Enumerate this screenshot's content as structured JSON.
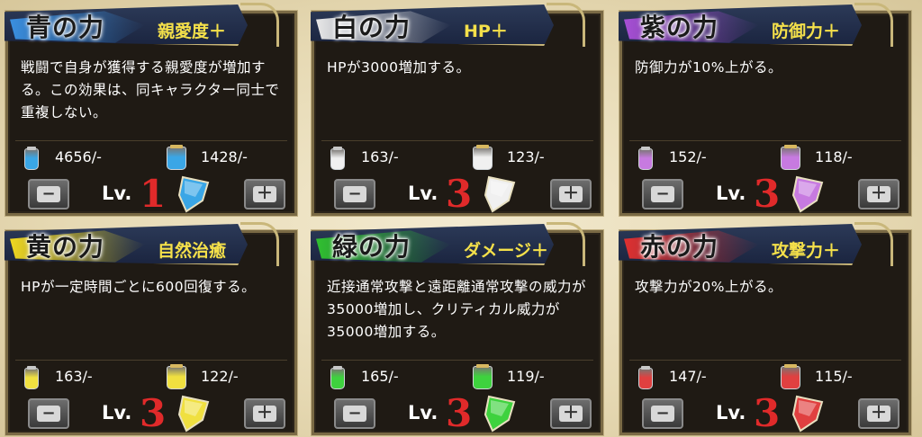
{
  "cards": [
    {
      "title": "青の力",
      "effect": "親愛度＋",
      "desc": "戦闘で自身が獲得する親愛度が増加する。この効果は、同キャラクター同士で重複しない。",
      "small_count": "4656/-",
      "big_count": "1428/-",
      "lv_label": "Lv.",
      "level": "1",
      "color": "#3aa6e6",
      "brush": "#3a8fe0"
    },
    {
      "title": "白の力",
      "effect": "HP＋",
      "desc": "HPが3000増加する。",
      "small_count": "163/-",
      "big_count": "123/-",
      "lv_label": "Lv.",
      "level": "3",
      "color": "#f0f0f0",
      "brush": "#e8e8e8"
    },
    {
      "title": "紫の力",
      "effect": "防御力＋",
      "desc": "防御力が10%上がる。",
      "small_count": "152/-",
      "big_count": "118/-",
      "lv_label": "Lv.",
      "level": "3",
      "color": "#c77ae0",
      "brush": "#a84fd6"
    },
    {
      "title": "黄の力",
      "effect": "自然治癒",
      "desc": "HPが一定時間ごとに600回復する。",
      "small_count": "163/-",
      "big_count": "122/-",
      "lv_label": "Lv.",
      "level": "3",
      "color": "#f0e040",
      "brush": "#f0d820"
    },
    {
      "title": "緑の力",
      "effect": "ダメージ＋",
      "desc": "近接通常攻撃と遠距離通常攻撃の威力が35000増加し、クリティカル威力が35000増加する。",
      "small_count": "165/-",
      "big_count": "119/-",
      "lv_label": "Lv.",
      "level": "3",
      "color": "#3ed23e",
      "brush": "#30c030"
    },
    {
      "title": "赤の力",
      "effect": "攻撃力＋",
      "desc": "攻撃力が20%上がる。",
      "small_count": "147/-",
      "big_count": "115/-",
      "lv_label": "Lv.",
      "level": "3",
      "color": "#e04040",
      "brush": "#e03030"
    }
  ],
  "icons": {
    "minus": "minus-icon",
    "plus": "plus-icon"
  },
  "button_symbols": {
    "minus": "−",
    "plus": "＋"
  }
}
